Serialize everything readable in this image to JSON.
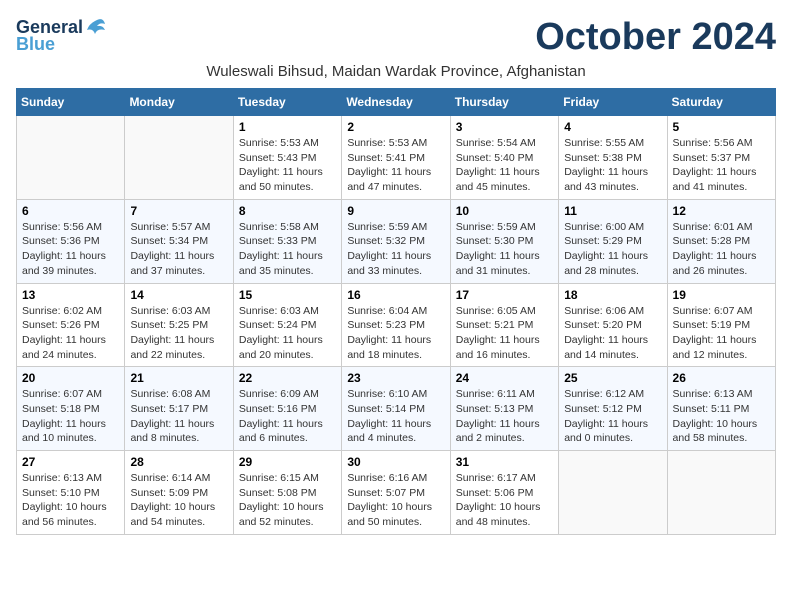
{
  "header": {
    "logo_general": "General",
    "logo_blue": "Blue",
    "month_year": "October 2024",
    "location": "Wuleswali Bihsud, Maidan Wardak Province, Afghanistan"
  },
  "weekdays": [
    "Sunday",
    "Monday",
    "Tuesday",
    "Wednesday",
    "Thursday",
    "Friday",
    "Saturday"
  ],
  "weeks": [
    [
      {
        "day": "",
        "sunrise": "",
        "sunset": "",
        "daylight": ""
      },
      {
        "day": "",
        "sunrise": "",
        "sunset": "",
        "daylight": ""
      },
      {
        "day": "1",
        "sunrise": "Sunrise: 5:53 AM",
        "sunset": "Sunset: 5:43 PM",
        "daylight": "Daylight: 11 hours and 50 minutes."
      },
      {
        "day": "2",
        "sunrise": "Sunrise: 5:53 AM",
        "sunset": "Sunset: 5:41 PM",
        "daylight": "Daylight: 11 hours and 47 minutes."
      },
      {
        "day": "3",
        "sunrise": "Sunrise: 5:54 AM",
        "sunset": "Sunset: 5:40 PM",
        "daylight": "Daylight: 11 hours and 45 minutes."
      },
      {
        "day": "4",
        "sunrise": "Sunrise: 5:55 AM",
        "sunset": "Sunset: 5:38 PM",
        "daylight": "Daylight: 11 hours and 43 minutes."
      },
      {
        "day": "5",
        "sunrise": "Sunrise: 5:56 AM",
        "sunset": "Sunset: 5:37 PM",
        "daylight": "Daylight: 11 hours and 41 minutes."
      }
    ],
    [
      {
        "day": "6",
        "sunrise": "Sunrise: 5:56 AM",
        "sunset": "Sunset: 5:36 PM",
        "daylight": "Daylight: 11 hours and 39 minutes."
      },
      {
        "day": "7",
        "sunrise": "Sunrise: 5:57 AM",
        "sunset": "Sunset: 5:34 PM",
        "daylight": "Daylight: 11 hours and 37 minutes."
      },
      {
        "day": "8",
        "sunrise": "Sunrise: 5:58 AM",
        "sunset": "Sunset: 5:33 PM",
        "daylight": "Daylight: 11 hours and 35 minutes."
      },
      {
        "day": "9",
        "sunrise": "Sunrise: 5:59 AM",
        "sunset": "Sunset: 5:32 PM",
        "daylight": "Daylight: 11 hours and 33 minutes."
      },
      {
        "day": "10",
        "sunrise": "Sunrise: 5:59 AM",
        "sunset": "Sunset: 5:30 PM",
        "daylight": "Daylight: 11 hours and 31 minutes."
      },
      {
        "day": "11",
        "sunrise": "Sunrise: 6:00 AM",
        "sunset": "Sunset: 5:29 PM",
        "daylight": "Daylight: 11 hours and 28 minutes."
      },
      {
        "day": "12",
        "sunrise": "Sunrise: 6:01 AM",
        "sunset": "Sunset: 5:28 PM",
        "daylight": "Daylight: 11 hours and 26 minutes."
      }
    ],
    [
      {
        "day": "13",
        "sunrise": "Sunrise: 6:02 AM",
        "sunset": "Sunset: 5:26 PM",
        "daylight": "Daylight: 11 hours and 24 minutes."
      },
      {
        "day": "14",
        "sunrise": "Sunrise: 6:03 AM",
        "sunset": "Sunset: 5:25 PM",
        "daylight": "Daylight: 11 hours and 22 minutes."
      },
      {
        "day": "15",
        "sunrise": "Sunrise: 6:03 AM",
        "sunset": "Sunset: 5:24 PM",
        "daylight": "Daylight: 11 hours and 20 minutes."
      },
      {
        "day": "16",
        "sunrise": "Sunrise: 6:04 AM",
        "sunset": "Sunset: 5:23 PM",
        "daylight": "Daylight: 11 hours and 18 minutes."
      },
      {
        "day": "17",
        "sunrise": "Sunrise: 6:05 AM",
        "sunset": "Sunset: 5:21 PM",
        "daylight": "Daylight: 11 hours and 16 minutes."
      },
      {
        "day": "18",
        "sunrise": "Sunrise: 6:06 AM",
        "sunset": "Sunset: 5:20 PM",
        "daylight": "Daylight: 11 hours and 14 minutes."
      },
      {
        "day": "19",
        "sunrise": "Sunrise: 6:07 AM",
        "sunset": "Sunset: 5:19 PM",
        "daylight": "Daylight: 11 hours and 12 minutes."
      }
    ],
    [
      {
        "day": "20",
        "sunrise": "Sunrise: 6:07 AM",
        "sunset": "Sunset: 5:18 PM",
        "daylight": "Daylight: 11 hours and 10 minutes."
      },
      {
        "day": "21",
        "sunrise": "Sunrise: 6:08 AM",
        "sunset": "Sunset: 5:17 PM",
        "daylight": "Daylight: 11 hours and 8 minutes."
      },
      {
        "day": "22",
        "sunrise": "Sunrise: 6:09 AM",
        "sunset": "Sunset: 5:16 PM",
        "daylight": "Daylight: 11 hours and 6 minutes."
      },
      {
        "day": "23",
        "sunrise": "Sunrise: 6:10 AM",
        "sunset": "Sunset: 5:14 PM",
        "daylight": "Daylight: 11 hours and 4 minutes."
      },
      {
        "day": "24",
        "sunrise": "Sunrise: 6:11 AM",
        "sunset": "Sunset: 5:13 PM",
        "daylight": "Daylight: 11 hours and 2 minutes."
      },
      {
        "day": "25",
        "sunrise": "Sunrise: 6:12 AM",
        "sunset": "Sunset: 5:12 PM",
        "daylight": "Daylight: 11 hours and 0 minutes."
      },
      {
        "day": "26",
        "sunrise": "Sunrise: 6:13 AM",
        "sunset": "Sunset: 5:11 PM",
        "daylight": "Daylight: 10 hours and 58 minutes."
      }
    ],
    [
      {
        "day": "27",
        "sunrise": "Sunrise: 6:13 AM",
        "sunset": "Sunset: 5:10 PM",
        "daylight": "Daylight: 10 hours and 56 minutes."
      },
      {
        "day": "28",
        "sunrise": "Sunrise: 6:14 AM",
        "sunset": "Sunset: 5:09 PM",
        "daylight": "Daylight: 10 hours and 54 minutes."
      },
      {
        "day": "29",
        "sunrise": "Sunrise: 6:15 AM",
        "sunset": "Sunset: 5:08 PM",
        "daylight": "Daylight: 10 hours and 52 minutes."
      },
      {
        "day": "30",
        "sunrise": "Sunrise: 6:16 AM",
        "sunset": "Sunset: 5:07 PM",
        "daylight": "Daylight: 10 hours and 50 minutes."
      },
      {
        "day": "31",
        "sunrise": "Sunrise: 6:17 AM",
        "sunset": "Sunset: 5:06 PM",
        "daylight": "Daylight: 10 hours and 48 minutes."
      },
      {
        "day": "",
        "sunrise": "",
        "sunset": "",
        "daylight": ""
      },
      {
        "day": "",
        "sunrise": "",
        "sunset": "",
        "daylight": ""
      }
    ]
  ]
}
